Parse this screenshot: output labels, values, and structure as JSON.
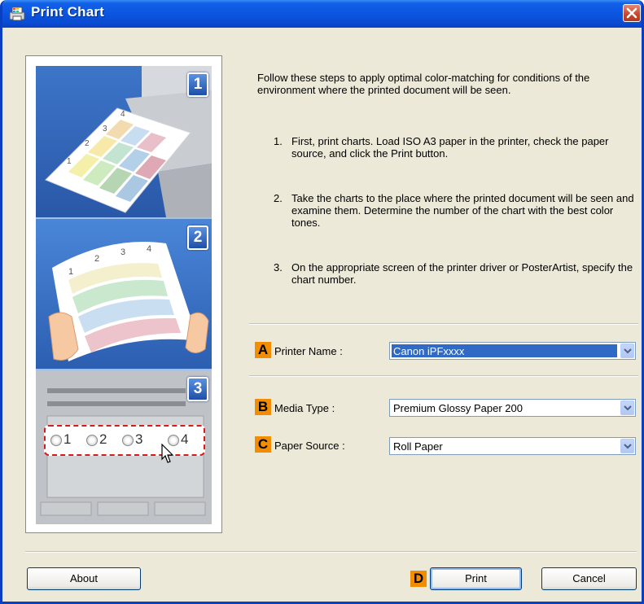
{
  "window": {
    "title": "Print Chart"
  },
  "intro": "Follow these steps to apply optimal color-matching for conditions of the environment where the printed document will be seen.",
  "steps": [
    {
      "num": "1.",
      "text": "First, print charts. Load ISO A3 paper in the printer, check the paper source, and click the Print button."
    },
    {
      "num": "2.",
      "text": "Take the charts to the place where the printed document will be seen and examine them. Determine the number of the chart with the best color tones."
    },
    {
      "num": "3.",
      "text": "On the appropriate screen of the printer driver or PosterArtist, specify the chart number."
    }
  ],
  "illustration": {
    "step_badges": [
      "1",
      "2",
      "3"
    ],
    "chart_numbers": [
      "1",
      "2",
      "3",
      "4"
    ]
  },
  "fields": {
    "printer_name": {
      "badge": "A",
      "label": "Printer Name :",
      "value": "Canon iPFxxxx"
    },
    "media_type": {
      "badge": "B",
      "label": "Media Type :",
      "value": "Premium Glossy Paper 200"
    },
    "paper_source": {
      "badge": "C",
      "label": "Paper Source :",
      "value": "Roll Paper"
    }
  },
  "buttons": {
    "about": "About",
    "print_badge": "D",
    "print": "Print",
    "cancel": "Cancel"
  },
  "colors": {
    "title_bar": "#0a4ad0",
    "badge": "#f28c00",
    "selection": "#316ac5"
  },
  "icons": {
    "app": "printer-chart-icon",
    "close": "close-icon",
    "dropdown": "chevron-down-icon",
    "cursor": "pointer-cursor-icon"
  }
}
